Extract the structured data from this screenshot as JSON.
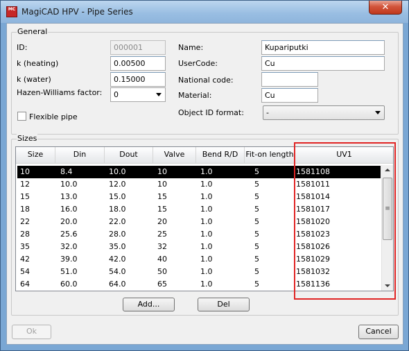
{
  "window": {
    "title": "MagiCAD HPV - Pipe Series",
    "close_label": "✕",
    "app_icon_text": "MC"
  },
  "general": {
    "group_label": "General",
    "id": {
      "label": "ID:",
      "value": "000001"
    },
    "k_heating": {
      "label": "k (heating)",
      "value": "0.00500"
    },
    "k_water": {
      "label": "k (water)",
      "value": "0.15000"
    },
    "hazen": {
      "label": "Hazen-Williams factor:",
      "value": "0"
    },
    "flexible": {
      "label": "Flexible pipe",
      "checked": false
    },
    "name": {
      "label": "Name:",
      "value": "Kupariputki"
    },
    "usercode": {
      "label": "UserCode:",
      "value": "Cu"
    },
    "national_code": {
      "label": "National code:",
      "value": ""
    },
    "material": {
      "label": "Material:",
      "value": "Cu"
    },
    "object_id_format": {
      "label": "Object ID format:",
      "value": "-"
    }
  },
  "sizes": {
    "group_label": "Sizes",
    "columns": [
      "Size",
      "Din",
      "Dout",
      "Valve",
      "Bend R/D",
      "Fit-on length",
      "UV1"
    ],
    "rows": [
      [
        "10",
        "8.4",
        "10.0",
        "10",
        "1.0",
        "5",
        "1581108"
      ],
      [
        "12",
        "10.0",
        "12.0",
        "10",
        "1.0",
        "5",
        "1581011"
      ],
      [
        "15",
        "13.0",
        "15.0",
        "15",
        "1.0",
        "5",
        "1581014"
      ],
      [
        "18",
        "16.0",
        "18.0",
        "15",
        "1.0",
        "5",
        "1581017"
      ],
      [
        "22",
        "20.0",
        "22.0",
        "20",
        "1.0",
        "5",
        "1581020"
      ],
      [
        "28",
        "25.6",
        "28.0",
        "25",
        "1.0",
        "5",
        "1581023"
      ],
      [
        "35",
        "32.0",
        "35.0",
        "32",
        "1.0",
        "5",
        "1581026"
      ],
      [
        "42",
        "39.0",
        "42.0",
        "40",
        "1.0",
        "5",
        "1581029"
      ],
      [
        "54",
        "51.0",
        "54.0",
        "50",
        "1.0",
        "5",
        "1581032"
      ],
      [
        "64",
        "60.0",
        "64.0",
        "65",
        "1.0",
        "5",
        "1581136"
      ]
    ],
    "selected_row": 0,
    "add_label": "Add...",
    "del_label": "Del"
  },
  "footer": {
    "ok_label": "Ok",
    "cancel_label": "Cancel"
  },
  "colors": {
    "highlight": "#e02424",
    "selection": "#000000"
  }
}
